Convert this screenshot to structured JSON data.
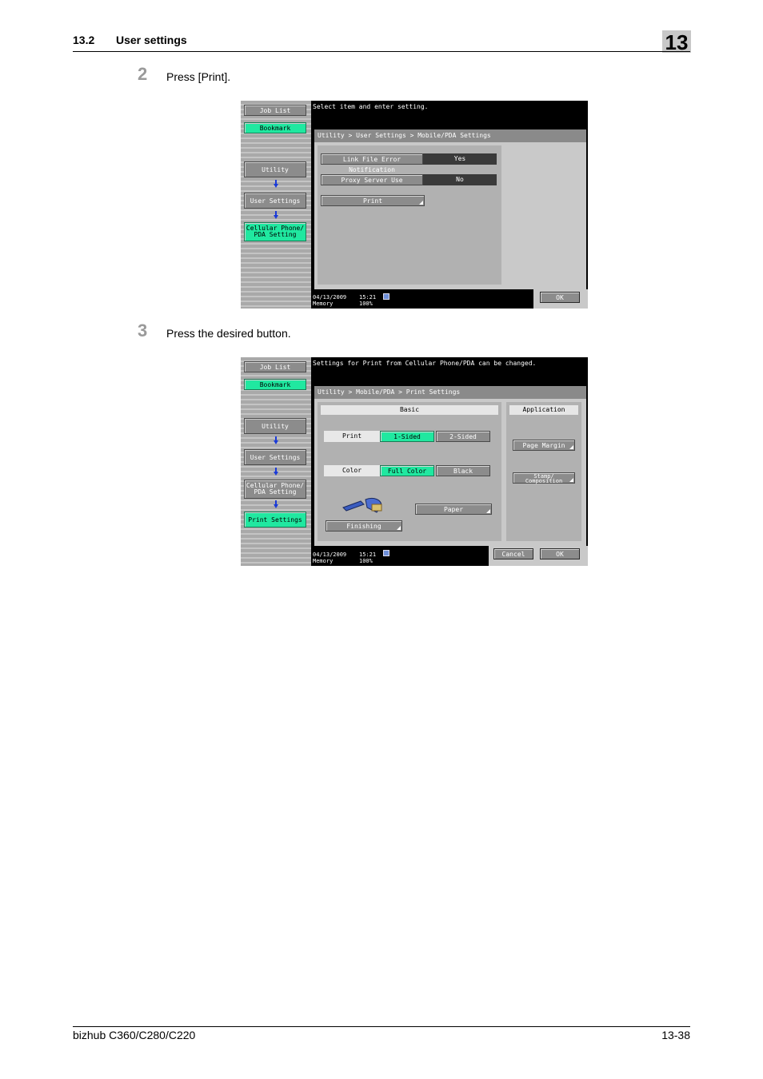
{
  "header": {
    "section": "13.2",
    "title": "User settings",
    "chapter": "13"
  },
  "steps": [
    {
      "number": "2",
      "text": "Press [Print]."
    },
    {
      "number": "3",
      "text": "Press the desired button."
    }
  ],
  "left_nav": {
    "job_list": "Job List",
    "bookmark": "Bookmark",
    "utility": "Utility",
    "user_settings": "User Settings",
    "cellular_line1": "Cellular Phone/",
    "cellular_line2": "PDA Setting",
    "print_settings": "Print Settings"
  },
  "screen1": {
    "message": "Select item and enter setting.",
    "breadcrumb": "Utility > User Settings > Mobile/PDA Settings",
    "rows": [
      {
        "label": "Link File Error Notification",
        "value": "Yes"
      },
      {
        "label": "Proxy Server Use",
        "value": "No"
      }
    ],
    "print_button": "Print",
    "ok": "OK"
  },
  "screen2": {
    "message": "Settings for Print from Cellular Phone/PDA can be changed.",
    "breadcrumb": "Utility > Mobile/PDA > Print Settings",
    "basic_header": "Basic",
    "application_header": "Application",
    "print_label": "Print",
    "one_sided": "1-Sided",
    "two_sided": "2-Sided",
    "color_label": "Color",
    "full_color": "Full Color",
    "black": "Black",
    "paper": "Paper",
    "finishing": "Finishing",
    "page_margin": "Page Margin",
    "stamp_line1": "Stamp/",
    "stamp_line2": "Composition",
    "cancel": "Cancel",
    "ok": "OK"
  },
  "status": {
    "date": "04/13/2009",
    "time": "15:21",
    "memory_label": "Memory",
    "memory_value": "100%"
  },
  "footer": {
    "product": "bizhub C360/C280/C220",
    "page": "13-38"
  }
}
